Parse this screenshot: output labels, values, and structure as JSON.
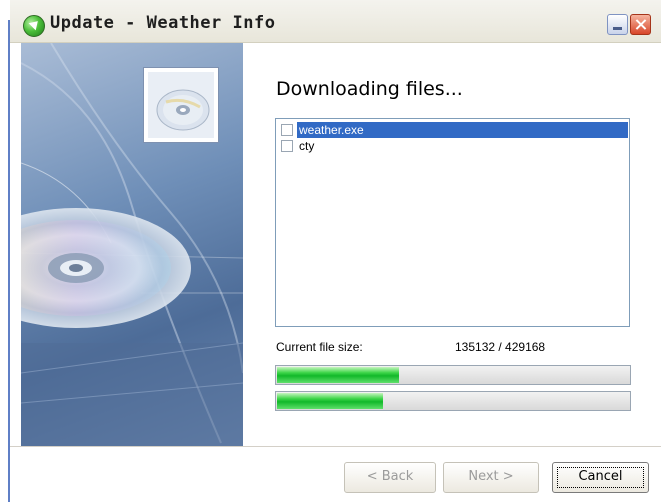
{
  "window": {
    "title": "Update - Weather Info"
  },
  "page": {
    "heading": "Downloading files..."
  },
  "files": [
    {
      "name": "weather.exe",
      "checked": false,
      "selected": true
    },
    {
      "name": "cty",
      "checked": false,
      "selected": false
    }
  ],
  "progress": {
    "size_label": "Current file size:",
    "size_value": "135132 / 429168",
    "file_progress_fraction": 0.3149,
    "total_progress_fraction": 0.3
  },
  "buttons": {
    "back": "< Back",
    "next": "Next >",
    "cancel": "Cancel",
    "back_enabled": false,
    "next_enabled": false
  },
  "colors": {
    "selection": "#316ac5",
    "progress_fill": "#12b82a",
    "close_button": "#d8462a"
  }
}
